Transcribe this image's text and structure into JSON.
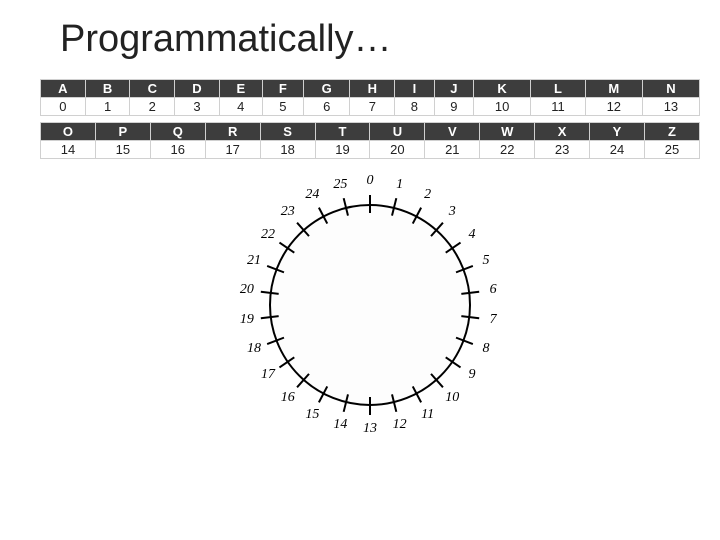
{
  "title": "Programmatically…",
  "table1": {
    "letters": [
      "A",
      "B",
      "C",
      "D",
      "E",
      "F",
      "G",
      "H",
      "I",
      "J",
      "K",
      "L",
      "M",
      "N"
    ],
    "numbers": [
      "0",
      "1",
      "2",
      "3",
      "4",
      "5",
      "6",
      "7",
      "8",
      "9",
      "10",
      "11",
      "12",
      "13"
    ]
  },
  "table2": {
    "letters": [
      "O",
      "P",
      "Q",
      "R",
      "S",
      "T",
      "U",
      "V",
      "W",
      "X",
      "Y",
      "Z"
    ],
    "numbers": [
      "14",
      "15",
      "16",
      "17",
      "18",
      "19",
      "20",
      "21",
      "22",
      "23",
      "24",
      "25"
    ]
  },
  "dial": {
    "count": 26,
    "labels": [
      "0",
      "1",
      "2",
      "3",
      "4",
      "5",
      "6",
      "7",
      "8",
      "9",
      "10",
      "11",
      "12",
      "13",
      "14",
      "15",
      "16",
      "17",
      "18",
      "19",
      "20",
      "21",
      "22",
      "23",
      "24",
      "25"
    ]
  }
}
